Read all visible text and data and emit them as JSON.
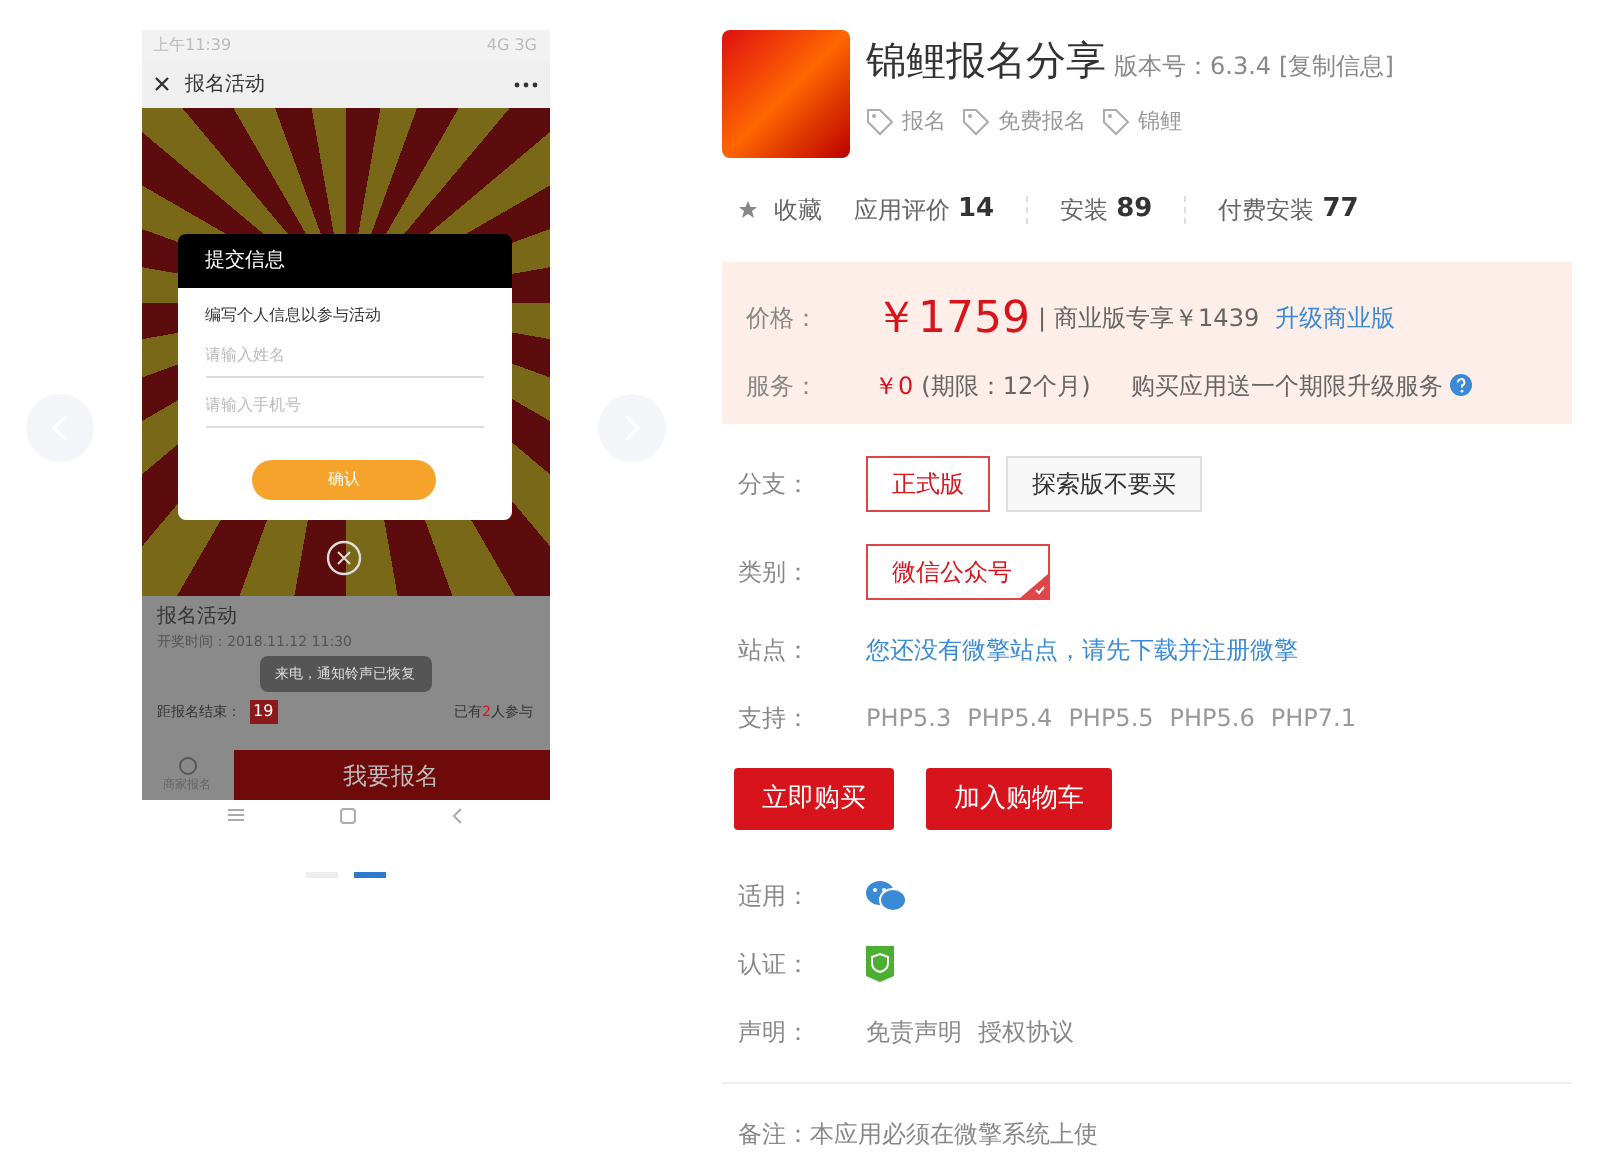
{
  "gallery": {
    "phone": {
      "status_time": "上午11:39",
      "status_network": "4G 3G",
      "page_title": "报名活动",
      "dialog": {
        "title": "提交信息",
        "subtitle": "编写个人信息以参与活动",
        "fields": [
          {
            "placeholder": "请输入姓名"
          },
          {
            "placeholder": "请输入手机号"
          }
        ],
        "confirm": "确认"
      },
      "activity": {
        "title": "报名活动",
        "draw_time": "开奖时间：2018.11.12 11:30",
        "toast": "来电，通知铃声已恢复",
        "countdown_label": "距报名结束：",
        "countdown_first": "19",
        "participants_prefix": "已有",
        "participants_count": "2",
        "participants_suffix": "人参与",
        "tab_label": "商家报名",
        "signup": "我要报名"
      }
    },
    "dots": [
      {
        "selected": false
      },
      {
        "selected": true
      }
    ]
  },
  "app": {
    "title": "锦鲤报名分享",
    "version": "版本号：6.3.4",
    "copy_link": "[复制信息]",
    "tags": [
      "报名",
      "免费报名",
      "锦鲤"
    ],
    "favorite": "收藏",
    "stats": [
      {
        "label": "应用评价",
        "value": "14"
      },
      {
        "label": "安装",
        "value": "89"
      },
      {
        "label": "付费安装",
        "value": "77"
      }
    ],
    "price": {
      "label": "价格：",
      "amount": "￥1759",
      "separator": "|",
      "business": "商业版专享￥1439",
      "upgrade": "升级商业版"
    },
    "service": {
      "label": "服务：",
      "amount": "￥0",
      "term": "(期限：12个月)",
      "note": "购买应用送一个期限升级服务"
    },
    "option_groups": [
      {
        "kind": "branch",
        "label": "分支：",
        "options": [
          {
            "label": "正式版",
            "selected": true
          },
          {
            "label": "探索版不要买",
            "selected": false
          }
        ]
      },
      {
        "kind": "category",
        "label": "类别：",
        "options": [
          {
            "label": "微信公众号",
            "selected": true
          }
        ]
      }
    ],
    "site": {
      "label": "站点：",
      "link": "您还没有微擎站点，请先下载并注册微擎"
    },
    "support": {
      "label": "支持：",
      "versions": [
        "PHP5.3",
        "PHP5.4",
        "PHP5.5",
        "PHP5.6",
        "PHP7.1"
      ]
    },
    "buttons": [
      "立即购买",
      "加入购物车"
    ],
    "applies_label": "适用：",
    "certify_label": "认证：",
    "statement": {
      "label": "声明：",
      "links": [
        "免责声明",
        "授权协议"
      ]
    },
    "note": "备注：本应用必须在微擎系统上使"
  }
}
